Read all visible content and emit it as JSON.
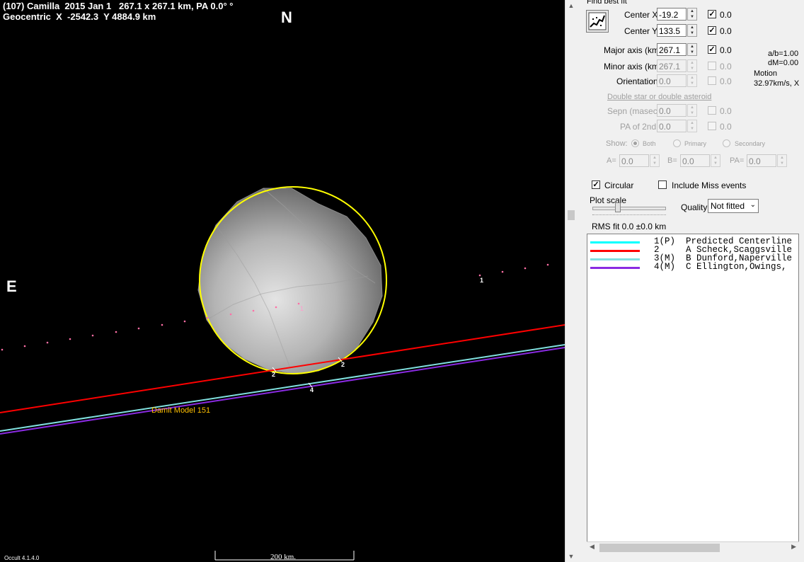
{
  "plot": {
    "title_line1": "(107) Camilla  2015 Jan 1   267.1 x 267.1 km, PA 0.0° °",
    "title_line2": "Geocentric  X  -2542.3  Y 4884.9 km",
    "north_label": "N",
    "east_label": "E",
    "model_label": "Damit Model 151",
    "scale_label": "200 km.",
    "version_label": "Occult 4.1.4.0",
    "chord_labels": [
      "1",
      "2",
      "2",
      "4"
    ],
    "colors": {
      "background": "#000000",
      "fit_circle": "#ffff00",
      "model_label": "#ffc000"
    }
  },
  "panel": {
    "find_best_fit_label": "Find best fit",
    "center_x": {
      "label": "Center X",
      "value": "-19.2",
      "fixed": "0.0"
    },
    "center_y": {
      "label": "Center Y",
      "value": "133.5",
      "fixed": "0.0"
    },
    "major_axis": {
      "label": "Major axis (km)",
      "value": "267.1",
      "fixed": "0.0"
    },
    "minor_axis": {
      "label": "Minor axis (km)",
      "value": "267.1",
      "fixed": "0.0"
    },
    "orientation": {
      "label": "Orientation",
      "value": "0.0",
      "fixed": "0.0"
    },
    "ratio_ab": "a/b=1.00",
    "dm": "dM=0.00",
    "motion_label": "Motion",
    "motion_value": "32.97km/s, X",
    "double_star_link": "Double star  or  double asteroid",
    "sepn": {
      "label": "Sepn (masec)",
      "value": "0.0",
      "fixed": "0.0"
    },
    "pa_2nd": {
      "label": "PA of 2nd",
      "value": "0.0",
      "fixed": "0.0"
    },
    "show_label": "Show:",
    "show_options": [
      "Both",
      "Primary",
      "Secondary"
    ],
    "a_label": "A=",
    "a_value": "0.0",
    "b_label": "B=",
    "b_value": "0.0",
    "pa_label": "PA=",
    "pa_value": "0.0",
    "circular_label": "Circular",
    "include_miss_label": "Include Miss events",
    "plot_scale_label": "Plot scale",
    "quality_label": "Quality",
    "quality_value": "Not fitted",
    "rms_fit": "RMS fit  0.0 ±0.0 km",
    "legend": [
      {
        "text": "1(P)  Predicted Centerline",
        "color": "#00ffff"
      },
      {
        "text": "2     A Scheck,Scaggsville",
        "color": "#ff0000"
      },
      {
        "text": "3(M)  B Dunford,Naperville",
        "color": "#80e0e0"
      },
      {
        "text": "4(M)  C Ellington,Owings,",
        "color": "#8a2be2"
      }
    ]
  }
}
